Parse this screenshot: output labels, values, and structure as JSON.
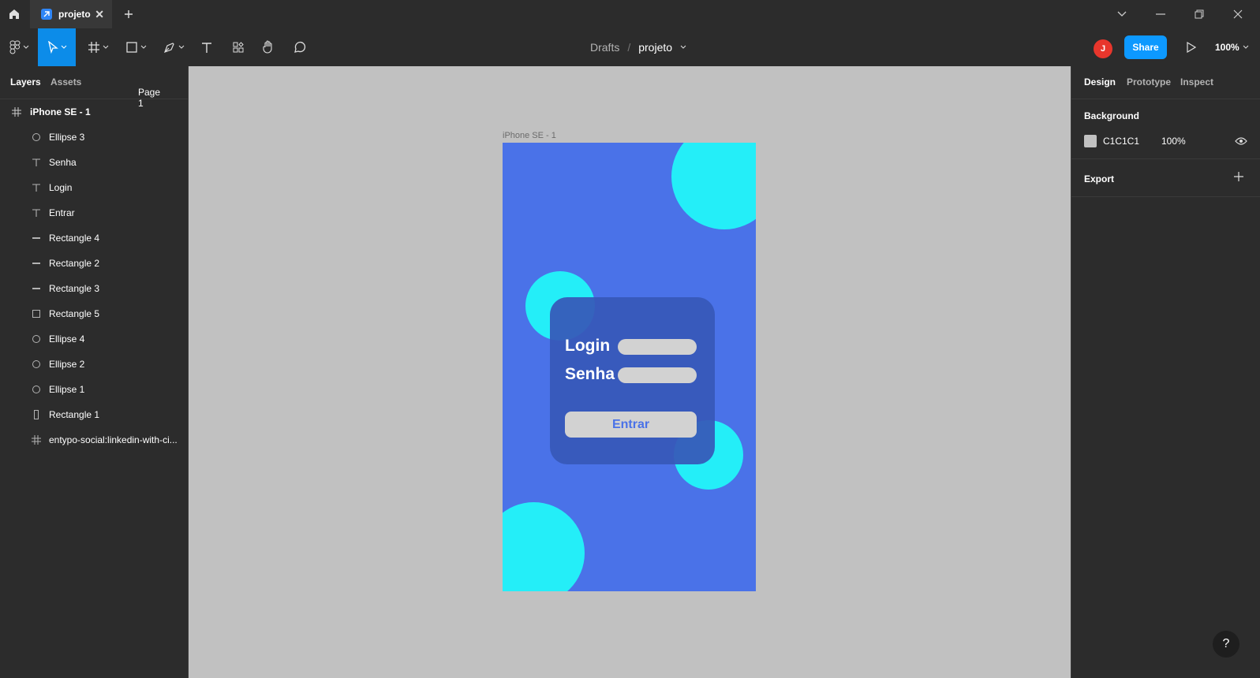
{
  "tab": {
    "title": "projeto"
  },
  "toolbar": {
    "breadcrumb_parent": "Drafts",
    "breadcrumb_sep": "/",
    "file_name": "projeto",
    "avatar_initial": "J",
    "share_label": "Share",
    "zoom": "100%"
  },
  "left_panel": {
    "tab_layers": "Layers",
    "tab_assets": "Assets",
    "page_selector": "Page 1",
    "frame_layer": "iPhone SE - 1",
    "layers": [
      {
        "label": "Ellipse 3",
        "icon": "ellipse-icon"
      },
      {
        "label": "Senha",
        "icon": "text-icon"
      },
      {
        "label": "Login",
        "icon": "text-icon"
      },
      {
        "label": "Entrar",
        "icon": "text-icon"
      },
      {
        "label": "Rectangle 4",
        "icon": "line-rect-icon"
      },
      {
        "label": "Rectangle 2",
        "icon": "line-rect-icon"
      },
      {
        "label": "Rectangle 3",
        "icon": "line-rect-icon"
      },
      {
        "label": "Rectangle 5",
        "icon": "rectangle-icon"
      },
      {
        "label": "Ellipse 4",
        "icon": "ellipse-icon"
      },
      {
        "label": "Ellipse 2",
        "icon": "ellipse-icon"
      },
      {
        "label": "Ellipse 1",
        "icon": "ellipse-icon"
      },
      {
        "label": "Rectangle 1",
        "icon": "tall-rect-icon"
      },
      {
        "label": "entypo-social:linkedin-with-ci...",
        "icon": "frame-icon"
      }
    ]
  },
  "canvas": {
    "frame_label": "iPhone SE - 1",
    "login_label": "Login",
    "senha_label": "Senha",
    "button_label": "Entrar",
    "colors": {
      "frame": "#4a72e8",
      "circle": "#24eef8",
      "card": "#3758b8",
      "field": "#d2d2d2"
    }
  },
  "right_panel": {
    "tab_design": "Design",
    "tab_prototype": "Prototype",
    "tab_inspect": "Inspect",
    "background_title": "Background",
    "background_hex": "C1C1C1",
    "background_opacity": "100%",
    "export_title": "Export"
  },
  "help_label": "?"
}
